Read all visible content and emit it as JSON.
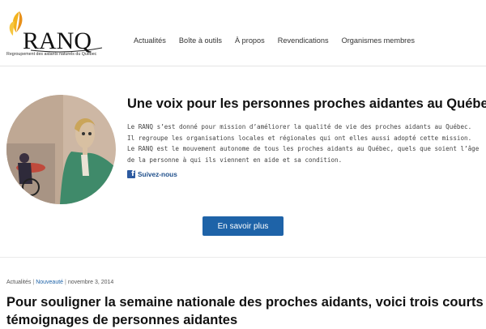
{
  "site": {
    "logo_text": "RANQ",
    "tagline": "Regroupement des aidants naturels du Québec"
  },
  "nav": {
    "items": [
      {
        "label": "Actualités"
      },
      {
        "label": "Boîte à outils"
      },
      {
        "label": "À propos"
      },
      {
        "label": "Revendications"
      },
      {
        "label": "Organismes membres"
      }
    ]
  },
  "hero": {
    "title": "Une voix pour les personnes proches aidantes au Québec",
    "body": "Le RANQ s’est donné pour mission d’améliorer la qualité de vie des proches aidants au Québec. Il regroupe les organisations locales et régionales qui ont elles aussi adopté cette mission. Le RANQ est le mouvement autonome de tous les proches aidants au Québec, quels que soient l’âge de la personne à qui ils viennent en aide et sa condition.",
    "social_label": "Suivez-nous",
    "cta_label": "En savoir plus"
  },
  "post": {
    "category": "Actualités",
    "tag": "Nouveauté",
    "date": "novembre 3, 2014",
    "title": "Pour souligner la semaine nationale des proches aidants, voici trois courts témoignages de personnes aidantes"
  },
  "colors": {
    "accent": "#1e63a8",
    "logo_orange": "#f0a020",
    "facebook": "#2c5aa0"
  }
}
